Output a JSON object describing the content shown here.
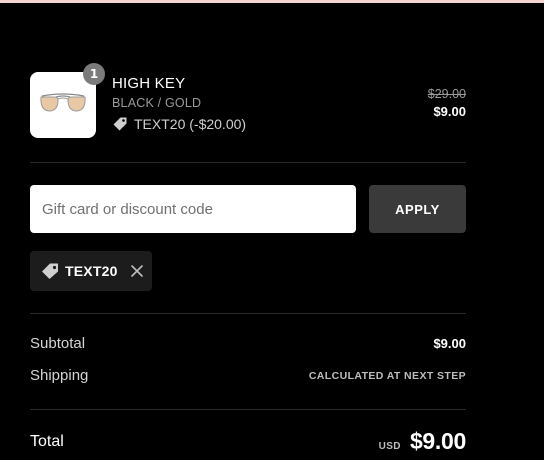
{
  "product": {
    "quantity": "1",
    "name": "HIGH KEY",
    "variant": "BLACK / GOLD",
    "discount_label": "TEXT20 (-$20.00)",
    "original_price": "$29.00",
    "final_price": "$9.00",
    "image_icon": "aviator-sunglasses-icon"
  },
  "discount_form": {
    "placeholder": "Gift card or discount code",
    "value": "",
    "apply_label": "APPLY"
  },
  "applied_discount": {
    "code": "TEXT20",
    "remove_icon": "close-icon"
  },
  "summary": {
    "subtotal_label": "Subtotal",
    "subtotal_value": "$9.00",
    "shipping_label": "Shipping",
    "shipping_value": "CALCULATED AT NEXT STEP",
    "total_label": "Total",
    "currency": "USD",
    "total_value": "$9.00"
  },
  "colors": {
    "background": "#000000",
    "top_strip": "#f6d4d1",
    "apply_button": "#3a3a3a",
    "chip_background": "#1c1c1c"
  }
}
